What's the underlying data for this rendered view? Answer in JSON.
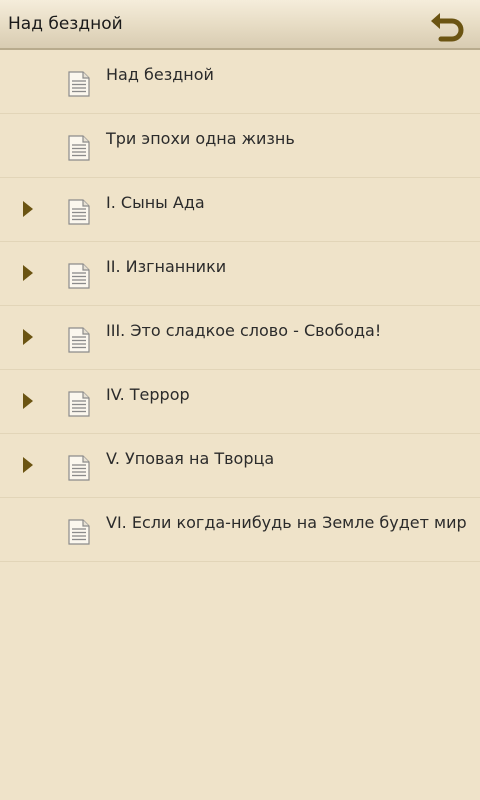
{
  "header": {
    "title": "Над бездной",
    "back_icon": "undo-arrow-icon"
  },
  "toc": {
    "items": [
      {
        "label": "Над бездной",
        "has_children": false,
        "icon": "document-icon"
      },
      {
        "label": "Три эпохи одна жизнь",
        "has_children": false,
        "icon": "document-icon"
      },
      {
        "label": "I. Сыны Ада",
        "has_children": true,
        "icon": "document-icon"
      },
      {
        "label": "II. Изгнанники",
        "has_children": true,
        "icon": "document-icon"
      },
      {
        "label": "III. Это сладкое слово - Свобода!",
        "has_children": true,
        "icon": "document-icon"
      },
      {
        "label": "IV. Террор",
        "has_children": true,
        "icon": "document-icon"
      },
      {
        "label": "V. Уповая на Творца",
        "has_children": true,
        "icon": "document-icon"
      },
      {
        "label": "VI. Если когда-нибудь на Земле будет мир",
        "has_children": false,
        "icon": "document-icon"
      }
    ]
  },
  "colors": {
    "background": "#efe3c9",
    "accent": "#6b5412",
    "text": "#2b2b2b"
  }
}
